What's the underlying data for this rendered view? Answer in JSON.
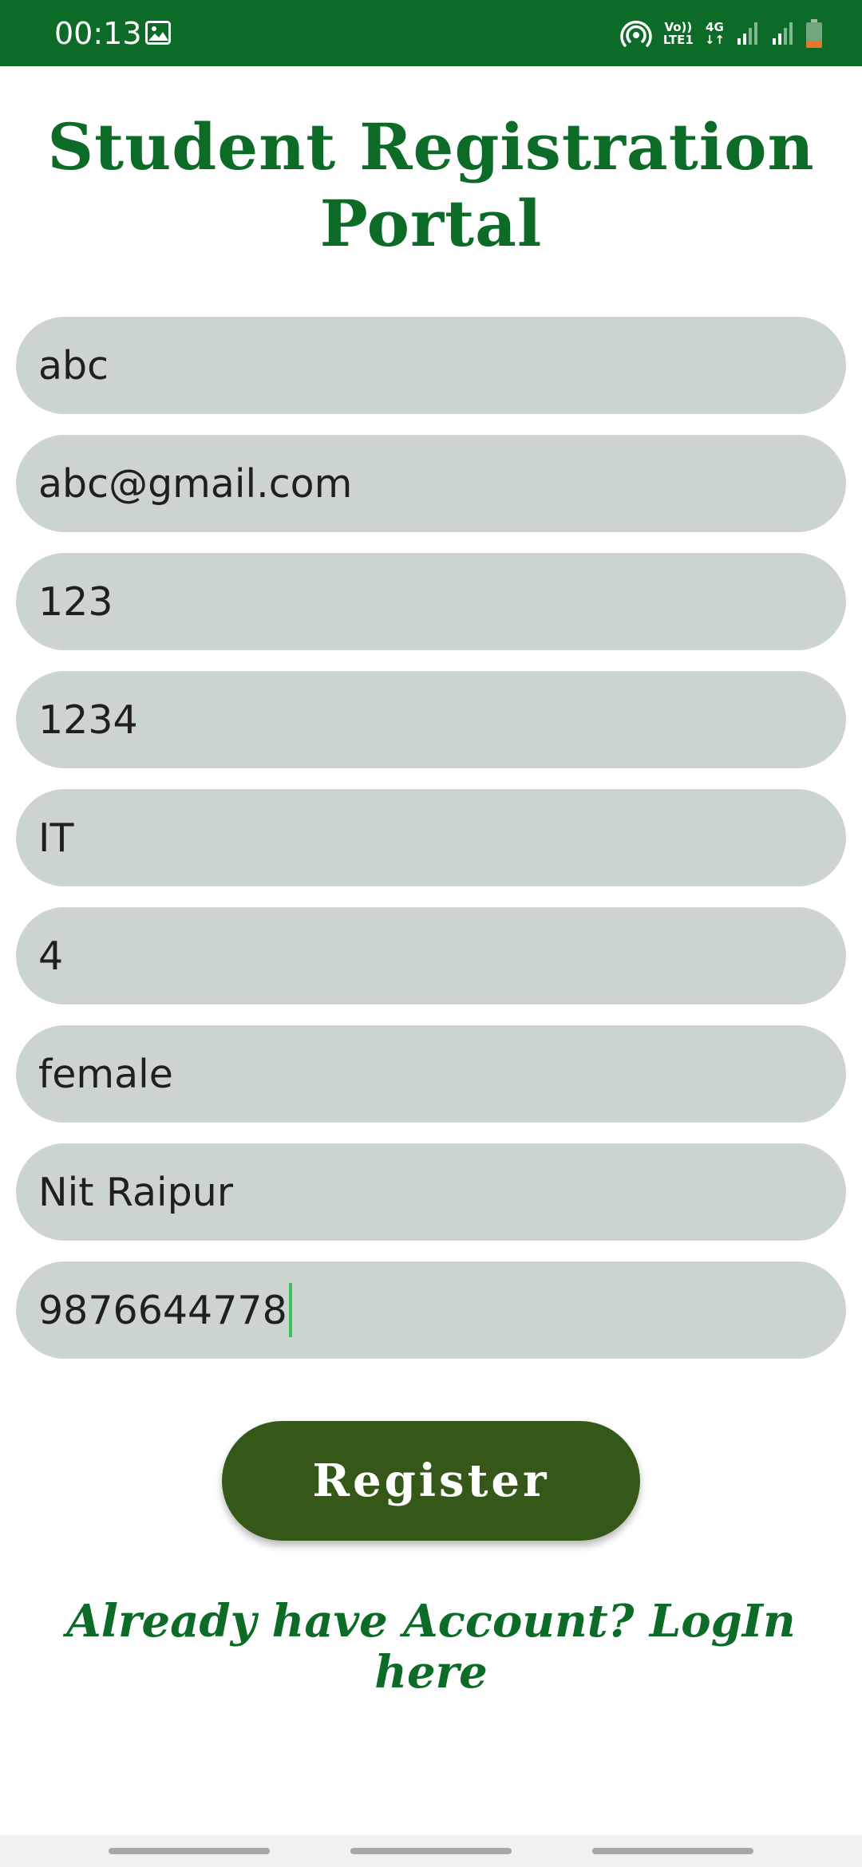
{
  "status_bar": {
    "time": "00:13",
    "volte_label": "Vo))",
    "lte_label": "LTE1",
    "network_label": "4G",
    "bg_color": "#0b6b27"
  },
  "page": {
    "title": "Student Registration Portal",
    "accent_color": "#0b6b27"
  },
  "form": {
    "fields": [
      {
        "value": "abc"
      },
      {
        "value": "abc@gmail.com"
      },
      {
        "value": "123"
      },
      {
        "value": "1234"
      },
      {
        "value": "IT"
      },
      {
        "value": "4"
      },
      {
        "value": "female"
      },
      {
        "value": "Nit Raipur"
      },
      {
        "value": "9876644778"
      }
    ],
    "field_bg_color": "#cbd4ce"
  },
  "register_button": {
    "label": "Register",
    "bg_color": "#355818"
  },
  "login_link": {
    "text": "Already have Account? LogIn here"
  }
}
